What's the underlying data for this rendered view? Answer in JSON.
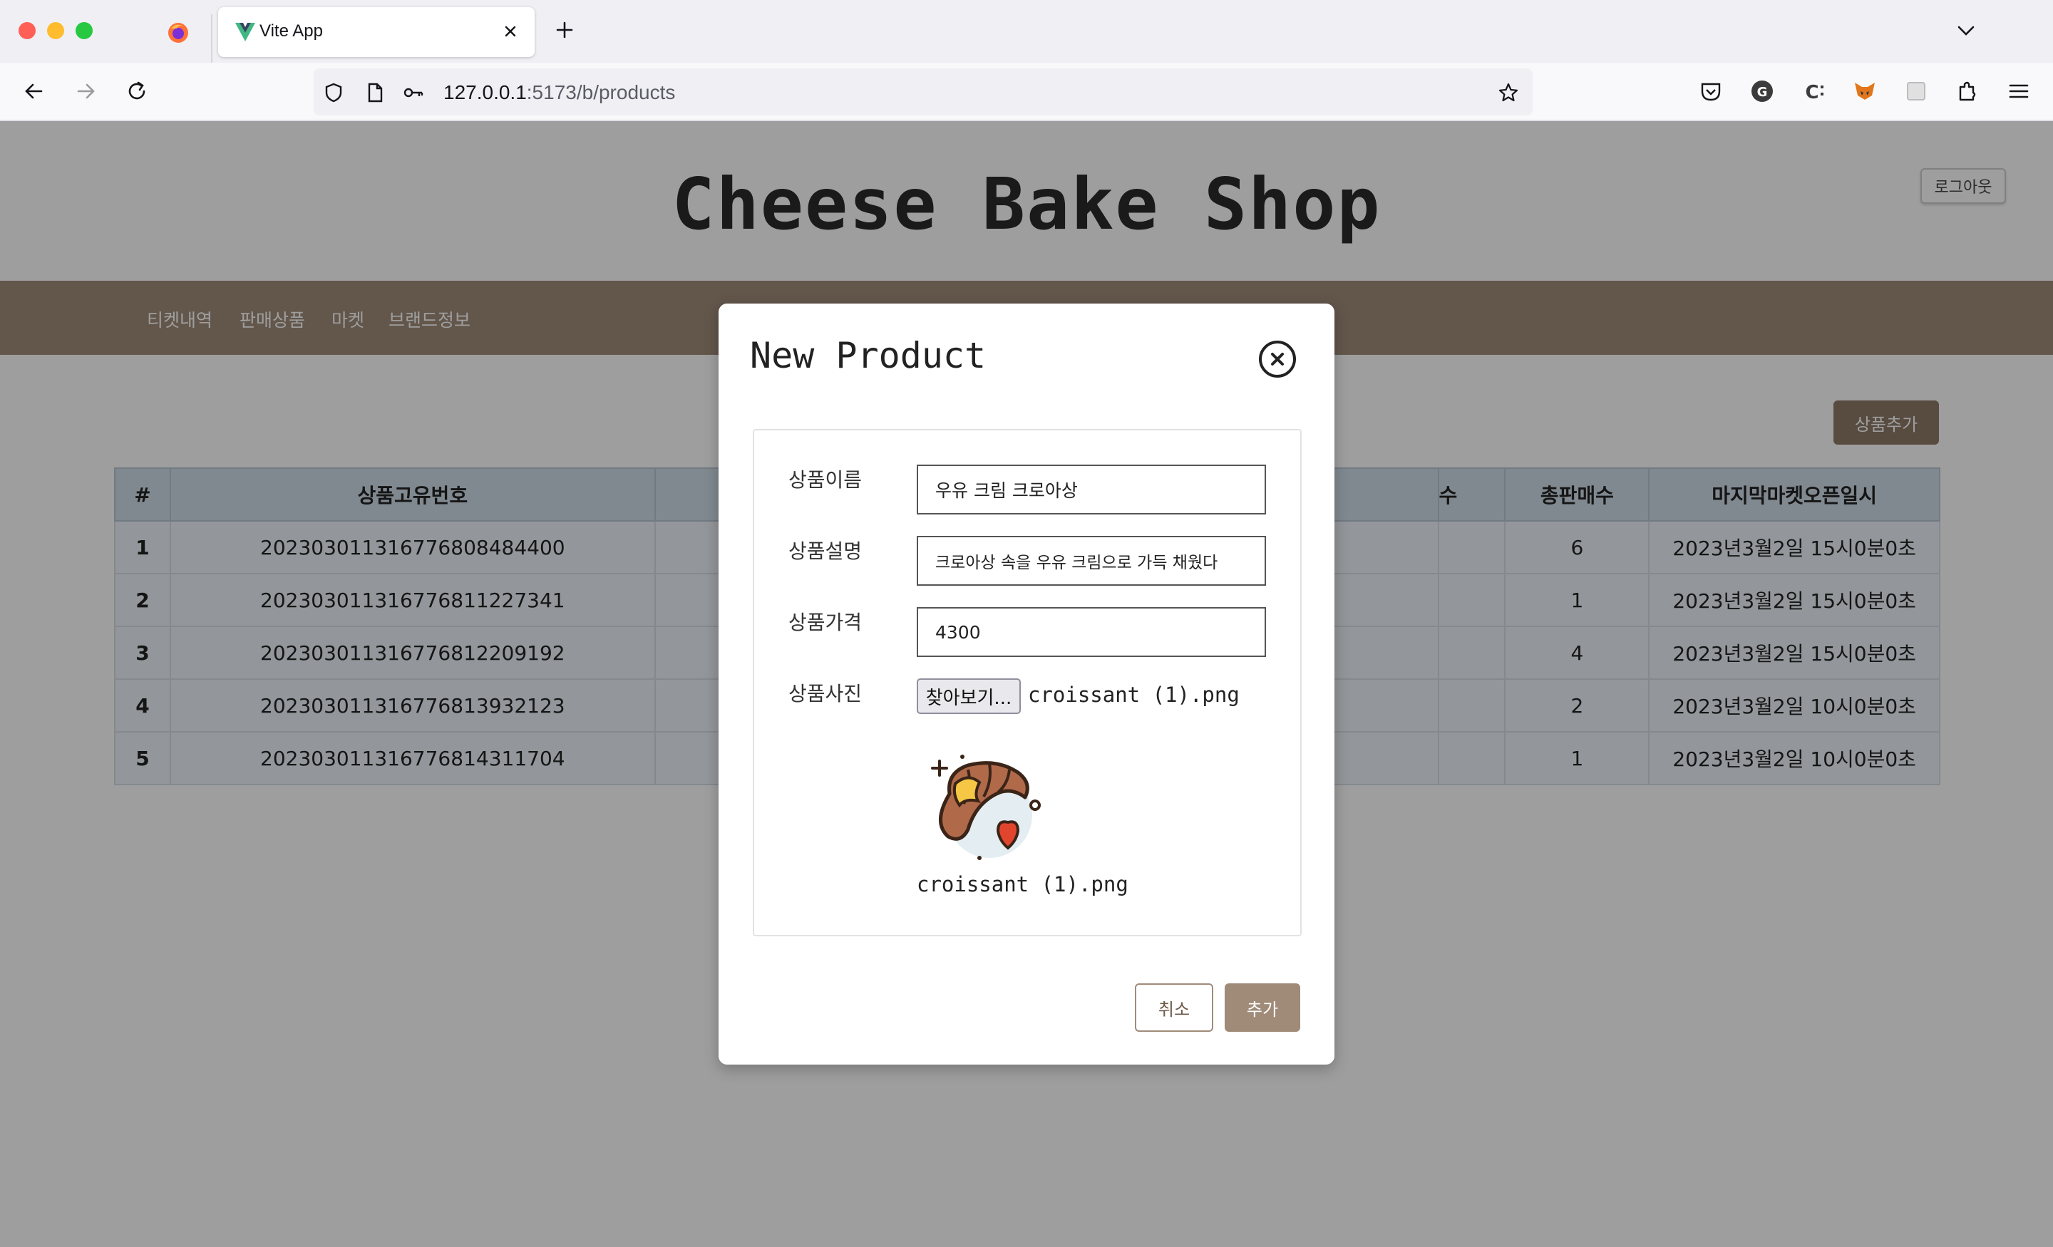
{
  "browser": {
    "tab_title": "Vite App",
    "url_host": "127.0.0.1",
    "url_rest": ":5173/b/products"
  },
  "site": {
    "title": "Cheese Bake Shop",
    "logout_label": "로그아웃",
    "menu": [
      "티켓내역",
      "판매상품",
      "마켓",
      "브랜드정보"
    ],
    "add_product_label": "상품추가"
  },
  "table": {
    "headers": [
      "#",
      "상품고유번호",
      "",
      "수",
      "총판매수",
      "마지막마켓오픈일시"
    ],
    "rows": [
      {
        "num": "1",
        "id": "20230301131677680848440​0",
        "total": "6",
        "opened": "2023년3월2일 15시0분0초"
      },
      {
        "num": "2",
        "id": "202303011316776811227341",
        "total": "1",
        "opened": "2023년3월2일 15시0분0초"
      },
      {
        "num": "3",
        "id": "202303011316776812209192",
        "total": "4",
        "opened": "2023년3월2일 15시0분0초"
      },
      {
        "num": "4",
        "id": "202303011316776813932123",
        "total": "2",
        "opened": "2023년3월2일 10시0분0초"
      },
      {
        "num": "5",
        "id": "202303011316776814311704",
        "total": "1",
        "opened": "2023년3월2일 10시0분0초"
      }
    ]
  },
  "modal": {
    "title": "New Product",
    "name_label": "상품이름",
    "name_value": "우유 크림 크로아상",
    "desc_label": "상품설명",
    "desc_value": "크로아상 속을 우유 크림으로 가득 채웠다",
    "price_label": "상품가격",
    "price_value": "4300",
    "photo_label": "상품사진",
    "browse_label": "찾아보기...",
    "file_name": "croissant (1).png",
    "preview_caption": "croissant (1).png",
    "cancel_label": "취소",
    "confirm_label": "추가"
  },
  "colors": {
    "accent": "#a08b79",
    "table_header": "#d1dde8"
  }
}
